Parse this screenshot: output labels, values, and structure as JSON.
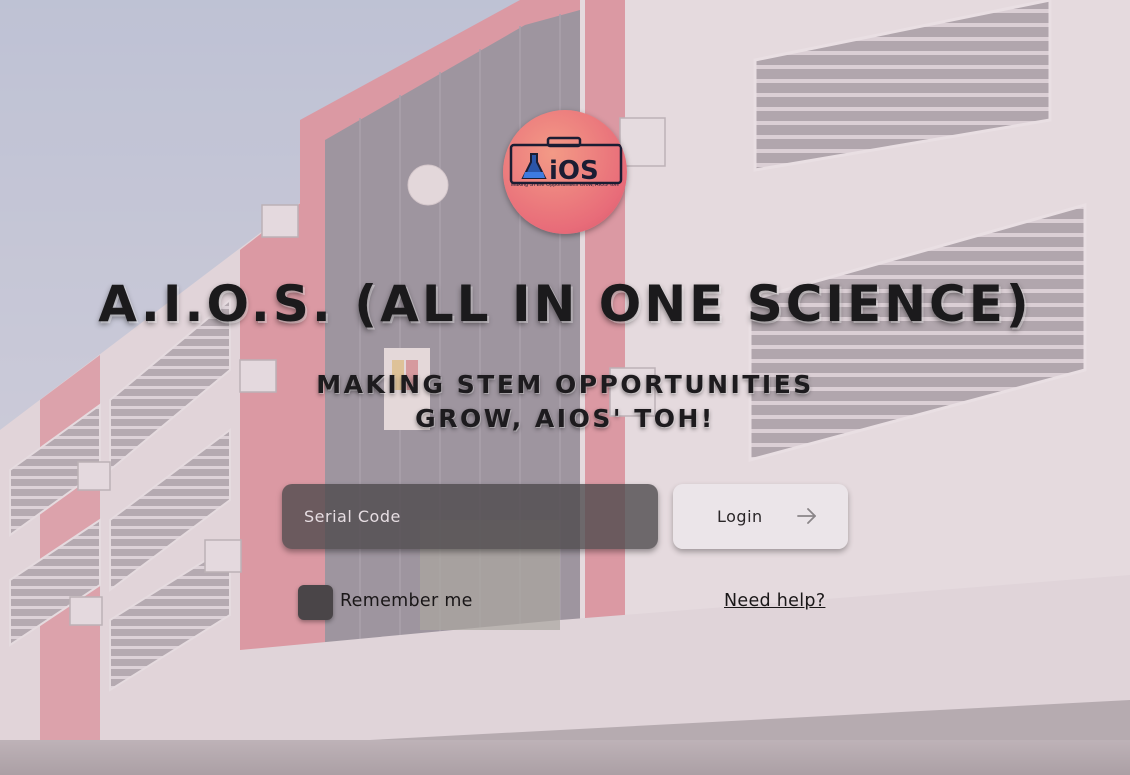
{
  "logo": {
    "word": "iOS",
    "tagline": "Making STEM Opportunities Grow, AIOS' toh!"
  },
  "hero": {
    "title": "A.I.O.S. (ALL IN ONE SCIENCE)",
    "subtitle_line1": "MAKING STEM OPPORTUNITIES",
    "subtitle_line2": "GROW, AIOS' TOH!"
  },
  "form": {
    "serial_placeholder": "Serial Code",
    "serial_value": "",
    "login_label": "Login",
    "login_icon": "arrow-right-icon",
    "remember_label": "Remember me",
    "remember_checked": false,
    "help_link": "Need help?"
  },
  "colors": {
    "overlay": "#d8c4cc",
    "logo_bg": "#e86c79",
    "input_bg": "#4b484a",
    "button_bg": "#ece6e9",
    "title_text": "#1b1a1c"
  }
}
